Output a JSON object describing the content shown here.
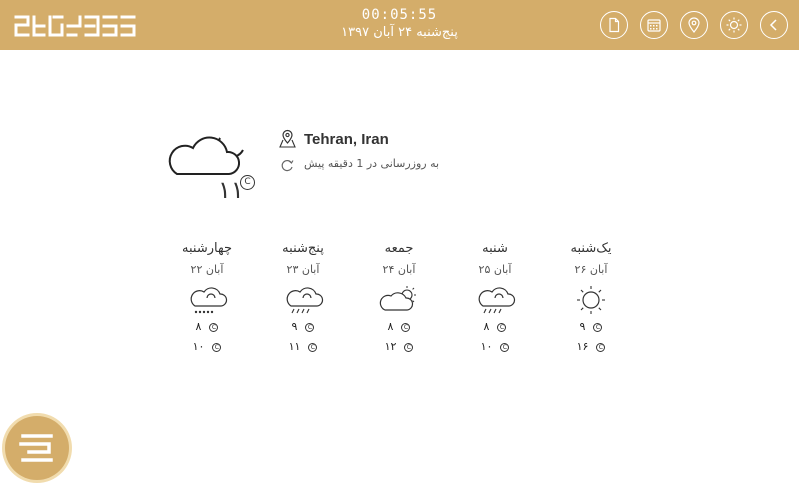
{
  "header": {
    "clock": "00:05:55",
    "date": "پنج‌شنبه ۲۴ آبان ۱۳۹۷"
  },
  "toolbar": {
    "icons": [
      "document-icon",
      "calendar-icon",
      "location-pin-icon",
      "sun-icon",
      "chevron-left-icon"
    ]
  },
  "current": {
    "location": "Tehran, Iran",
    "updated": "به روزرسانی در 1 دقیقه پیش",
    "temperature": "۱۱",
    "unit": "C",
    "icon": "cloud-moon-icon"
  },
  "forecast": [
    {
      "day": "چهارشنبه",
      "date": "۲۲ آبان",
      "icon": "cloud-snow-icon",
      "min": "۸",
      "max": "۱۰"
    },
    {
      "day": "پنج‌شنبه",
      "date": "۲۳ آبان",
      "icon": "cloud-rain-icon",
      "min": "۹",
      "max": "۱۱"
    },
    {
      "day": "جمعه",
      "date": "۲۴ آبان",
      "icon": "cloud-sun-icon",
      "min": "۸",
      "max": "۱۲"
    },
    {
      "day": "شنبه",
      "date": "۲۵ آبان",
      "icon": "cloud-rain-icon",
      "min": "۸",
      "max": "۱۰"
    },
    {
      "day": "یک‌شنبه",
      "date": "۲۶ آبان",
      "icon": "sun-icon",
      "min": "۹",
      "max": "۱۶"
    }
  ],
  "unit_symbol": "C",
  "colors": {
    "brand": "#d4ad6a",
    "brand_light": "#f1dcae",
    "text": "#333333"
  }
}
